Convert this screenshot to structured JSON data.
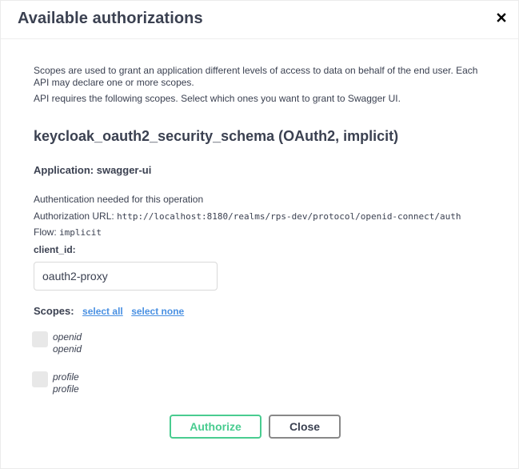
{
  "modal": {
    "title": "Available authorizations",
    "close_icon": "close-icon"
  },
  "description": {
    "p1": "Scopes are used to grant an application different levels of access to data on behalf of the end user. Each API may declare one or more scopes.",
    "p2": "API requires the following scopes. Select which ones you want to grant to Swagger UI."
  },
  "scheme": {
    "title": "keycloak_oauth2_security_schema (OAuth2, implicit)",
    "application_label": "Application:",
    "application_value": "swagger-ui",
    "auth_needed": "Authentication needed for this operation",
    "auth_url_label": "Authorization URL:",
    "auth_url": "http://localhost:8180/realms/rps-dev/protocol/openid-connect/auth",
    "flow_label": "Flow:",
    "flow": "implicit"
  },
  "client_id": {
    "label": "client_id:",
    "value": "oauth2-proxy"
  },
  "scopes": {
    "label": "Scopes:",
    "select_all": "select all",
    "select_none": "select none",
    "items": [
      {
        "name": "openid",
        "description": "openid",
        "checked": false
      },
      {
        "name": "profile",
        "description": "profile",
        "checked": false
      }
    ]
  },
  "buttons": {
    "authorize": "Authorize",
    "close": "Close"
  },
  "colors": {
    "authorize": "#49cc90",
    "link": "#4990e2",
    "text": "#3b4151"
  }
}
